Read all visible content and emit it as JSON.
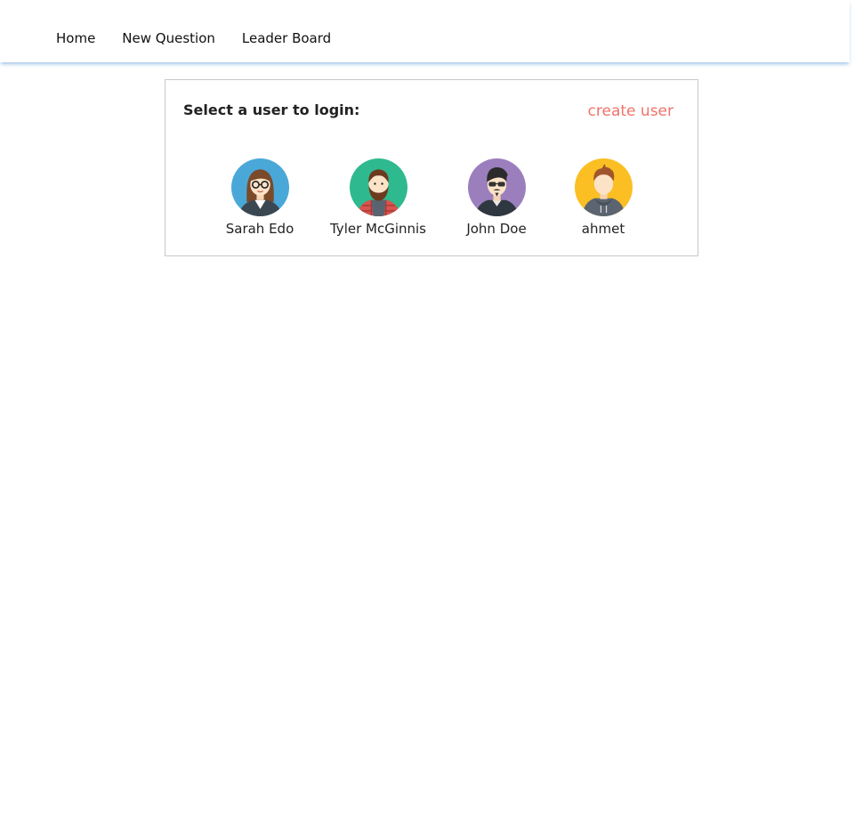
{
  "nav": {
    "links": [
      "Home",
      "New Question",
      "Leader Board"
    ]
  },
  "login": {
    "title": "Select a user to login:",
    "create_user_label": "create user",
    "users": [
      {
        "name": "Sarah Edo",
        "avatar_icon": "woman-glasses-avatar-icon",
        "bg": "#4aa8d8"
      },
      {
        "name": "Tyler McGinnis",
        "avatar_icon": "bearded-man-avatar-icon",
        "bg": "#2fb98e"
      },
      {
        "name": "John Doe",
        "avatar_icon": "man-sunglasses-avatar-icon",
        "bg": "#9b7fbd"
      },
      {
        "name": "ahmet",
        "avatar_icon": "man-hoodie-avatar-icon",
        "bg": "#fbbf24"
      }
    ]
  },
  "colors": {
    "accent": "#f0736b",
    "nav_shadow": "#5096d2",
    "panel_border": "#c8c8c8"
  }
}
